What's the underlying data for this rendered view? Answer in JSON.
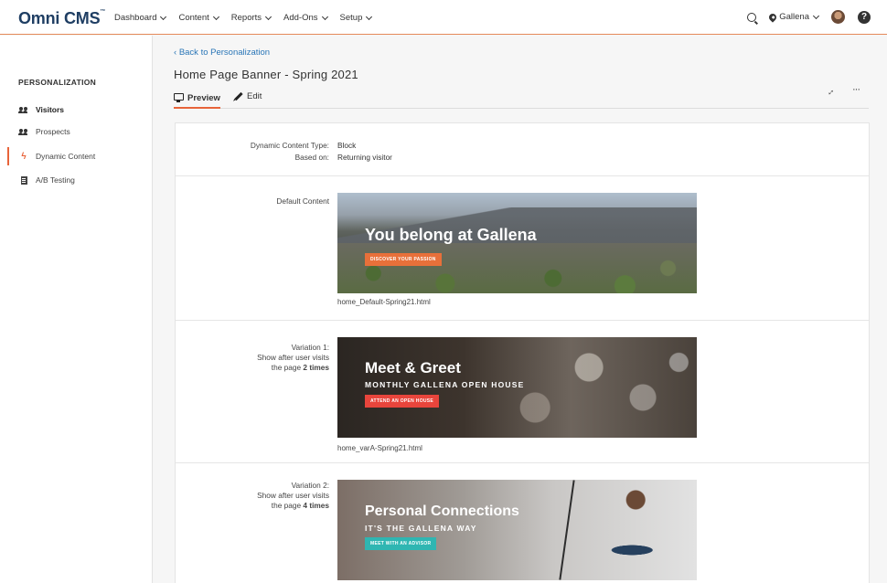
{
  "app": {
    "logo": "Omni CMS"
  },
  "nav": {
    "menu": [
      "Dashboard",
      "Content",
      "Reports",
      "Add-Ons",
      "Setup"
    ],
    "site": "Gallena"
  },
  "sidebar": {
    "title": "PERSONALIZATION",
    "items": [
      {
        "label": "Visitors",
        "icon": "visitors-icon"
      },
      {
        "label": "Prospects",
        "icon": "prospects-icon"
      },
      {
        "label": "Dynamic Content",
        "icon": "lightning-icon"
      },
      {
        "label": "A/B Testing",
        "icon": "document-icon"
      }
    ]
  },
  "main": {
    "back": "Back to Personalization",
    "title": "Home Page Banner - Spring 2021",
    "tabs": [
      "Preview",
      "Edit"
    ],
    "details": {
      "type_label": "Dynamic Content Type:",
      "type_value": "Block",
      "based_label": "Based on:",
      "based_value": "Returning visitor"
    },
    "default": {
      "label": "Default Content",
      "headline": "You belong at Gallena",
      "cta": "DISCOVER YOUR PASSION",
      "filename": "home_Default-Spring21.html"
    },
    "variation1": {
      "label1": "Variation 1:",
      "label2": "Show after user visits",
      "label3_pre": "the page ",
      "label3_bold": "2 times",
      "headline": "Meet & Greet",
      "sub": "MONTHLY GALLENA OPEN HOUSE",
      "cta": "ATTEND AN OPEN HOUSE",
      "filename": "home_varA-Spring21.html"
    },
    "variation2": {
      "label1": "Variation 2:",
      "label2": "Show after user visits",
      "label3_pre": "the page ",
      "label3_bold": "4 times",
      "headline": "Personal Connections",
      "sub": "IT'S THE GALLENA WAY",
      "cta": "MEET WITH AN ADVISOR"
    }
  },
  "colors": {
    "accent": "#e8643a",
    "link": "#2a76b7",
    "cta_default": "#e8703a",
    "cta_var1": "#e8453c",
    "cta_var2": "#2fb6b2"
  }
}
